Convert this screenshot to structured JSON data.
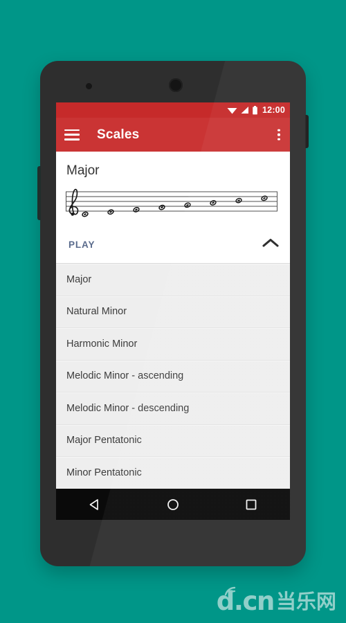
{
  "theme": {
    "background": "#009688",
    "status_bar": "#c62a2a",
    "app_bar": "#ca3434",
    "device_body": "#2e2e2e",
    "list_background": "#eeeeee",
    "accent_text": "#5a6b8c",
    "nav_bar": "#0a0a0a"
  },
  "status_bar": {
    "time": "12:00",
    "icons": [
      "wifi-icon",
      "signal-icon",
      "battery-icon"
    ]
  },
  "app_bar": {
    "title": "Scales",
    "menu_icon": "hamburger-menu-icon",
    "overflow_icon": "overflow-menu-icon"
  },
  "detail_card": {
    "title": "Major",
    "play_label": "PLAY",
    "collapse_icon": "chevron-up-icon",
    "notation": {
      "clef": "treble-clef",
      "staff_lines": 5,
      "note_count": 8,
      "notes": [
        "C",
        "D",
        "E",
        "F",
        "G",
        "A",
        "B",
        "C"
      ],
      "note_style": "whole-note",
      "direction": "ascending"
    }
  },
  "scale_list": {
    "items": [
      {
        "label": "Major"
      },
      {
        "label": "Natural Minor"
      },
      {
        "label": "Harmonic Minor"
      },
      {
        "label": "Melodic Minor - ascending"
      },
      {
        "label": "Melodic Minor - descending"
      },
      {
        "label": "Major Pentatonic"
      },
      {
        "label": "Minor Pentatonic"
      }
    ]
  },
  "nav_bar": {
    "back_label": "back-button",
    "home_label": "home-button",
    "recents_label": "recents-button"
  },
  "watermark": {
    "latin": "d.cn",
    "chinese": "当乐网"
  }
}
